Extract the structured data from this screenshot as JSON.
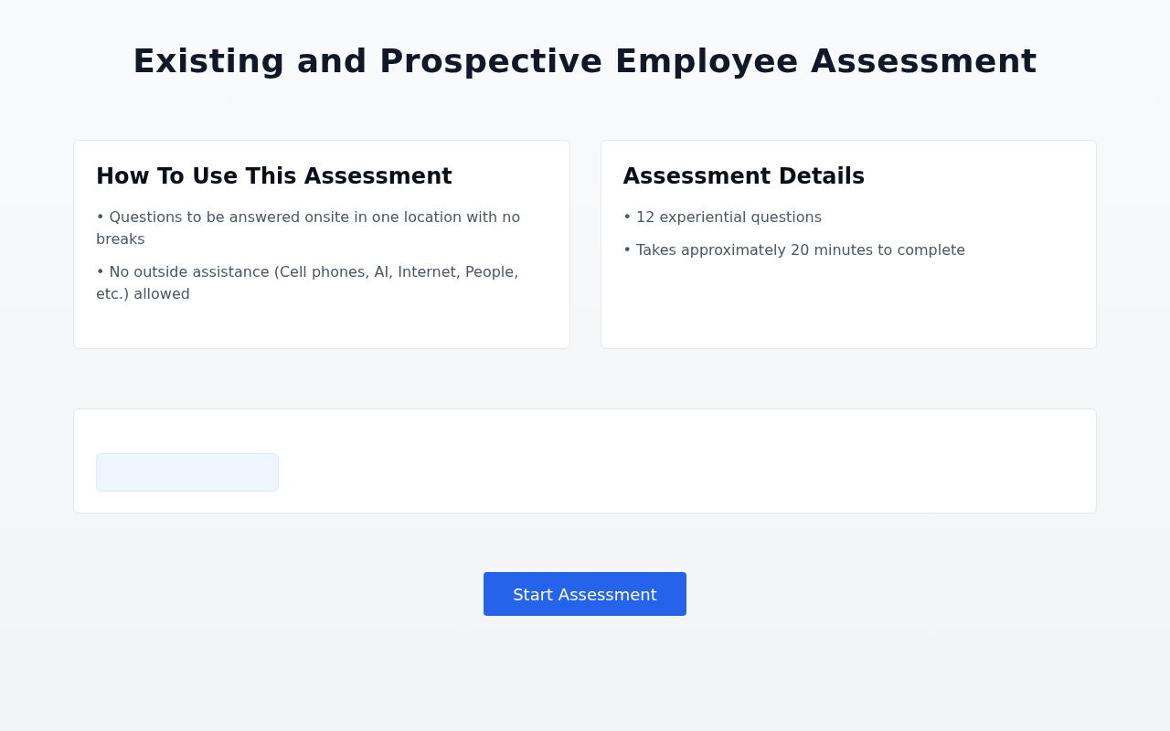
{
  "title": "Existing and Prospective Employee Assessment",
  "cards": [
    {
      "heading": "How To Use This Assessment",
      "items": [
        "• Questions to be answered onsite in one location with no breaks",
        "• No outside assistance (Cell phones, AI, Internet, People, etc.) allowed"
      ]
    },
    {
      "heading": "Assessment Details",
      "items": [
        "• 12 experiential questions",
        "• Takes approximately 20 minutes to complete"
      ]
    }
  ],
  "start_button": {
    "label": "Start Assessment"
  }
}
